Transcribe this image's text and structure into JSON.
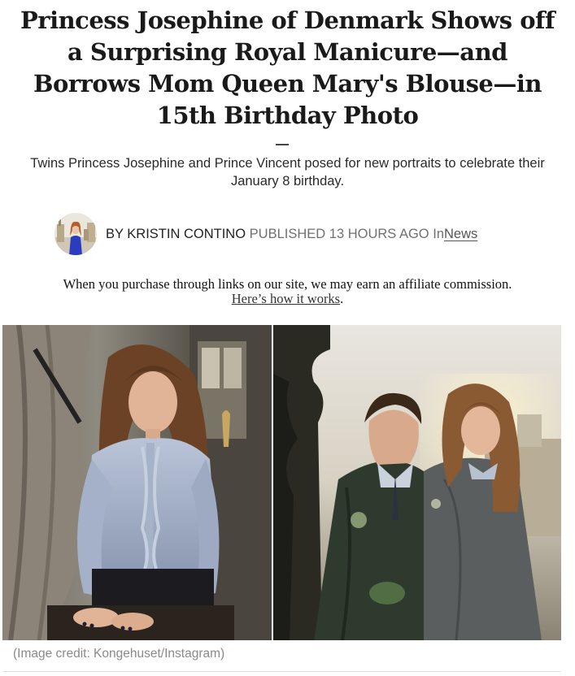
{
  "article": {
    "headline": "Princess Josephine of Denmark Shows off a Surprising Royal Manicure—and Borrows Mom Queen Mary's Blouse—in 15th Birthday Photo",
    "standfirst": "Twins Princess Josephine and Prince Vincent posed for new portraits to celebrate their January 8 birthday."
  },
  "byline": {
    "author": "BY KRISTIN CONTINO",
    "published": "PUBLISHED 13 HOURS AGO",
    "in_label": "In",
    "category": "News"
  },
  "disclosure": {
    "text": "When you purchase through links on our site, we may earn an affiliate commission.",
    "link_text": "Here’s how it works",
    "suffix": "."
  },
  "image": {
    "credit": "(Image credit:  Kongehuset/Instagram)"
  },
  "colors": {
    "headline": "#1a1a1a",
    "meta_grey": "#707070",
    "credit_grey": "#8a8a8a"
  }
}
